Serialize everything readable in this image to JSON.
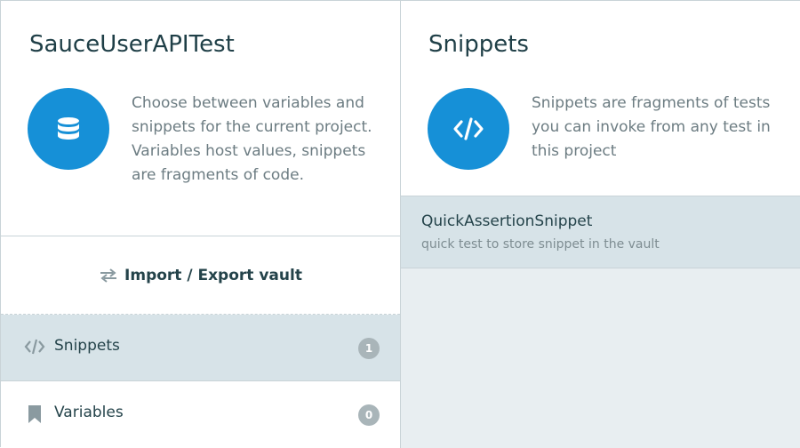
{
  "left": {
    "title": "SauceUserAPITest",
    "icon": "database-icon",
    "description": "Choose between variables and snippets for the current project. Variables host values, snippets are fragments of code.",
    "import_export_label": "Import / Export vault",
    "nav": [
      {
        "label": "Snippets",
        "count": "1",
        "icon": "code-icon",
        "active": true
      },
      {
        "label": "Variables",
        "count": "0",
        "icon": "bookmark-icon",
        "active": false
      }
    ]
  },
  "right": {
    "title": "Snippets",
    "icon": "code-icon",
    "description": "Snippets are fragments of tests you can invoke from any test in this project",
    "snippets": [
      {
        "name": "QuickAssertionSnippet",
        "description": "quick test to store snippet in the vault"
      }
    ]
  },
  "colors": {
    "accent": "#1690d7",
    "active_row": "#d7e3e8",
    "panel_bg": "#e8eef1",
    "badge": "#a9b5b9"
  }
}
